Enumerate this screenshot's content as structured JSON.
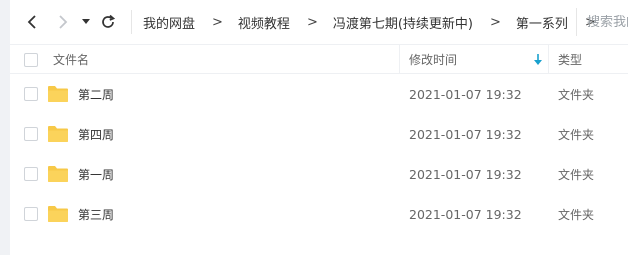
{
  "nav": {
    "crumbs": [
      "我的网盘",
      "视频教程",
      "冯渡第七期(持续更新中)",
      "第一系列"
    ],
    "separator": ">",
    "search_placeholder": "搜索我的文件"
  },
  "table": {
    "headers": {
      "name": "文件名",
      "modified": "修改时间",
      "type": "类型"
    },
    "rows": [
      {
        "name": "第二周",
        "modified": "2021-01-07 19:32",
        "type": "文件夹"
      },
      {
        "name": "第四周",
        "modified": "2021-01-07 19:32",
        "type": "文件夹"
      },
      {
        "name": "第一周",
        "modified": "2021-01-07 19:32",
        "type": "文件夹"
      },
      {
        "name": "第三周",
        "modified": "2021-01-07 19:32",
        "type": "文件夹"
      }
    ]
  },
  "colors": {
    "folder": "#f7c948",
    "sort_arrow": "#19a1ce",
    "separator": "#eef0f3"
  }
}
